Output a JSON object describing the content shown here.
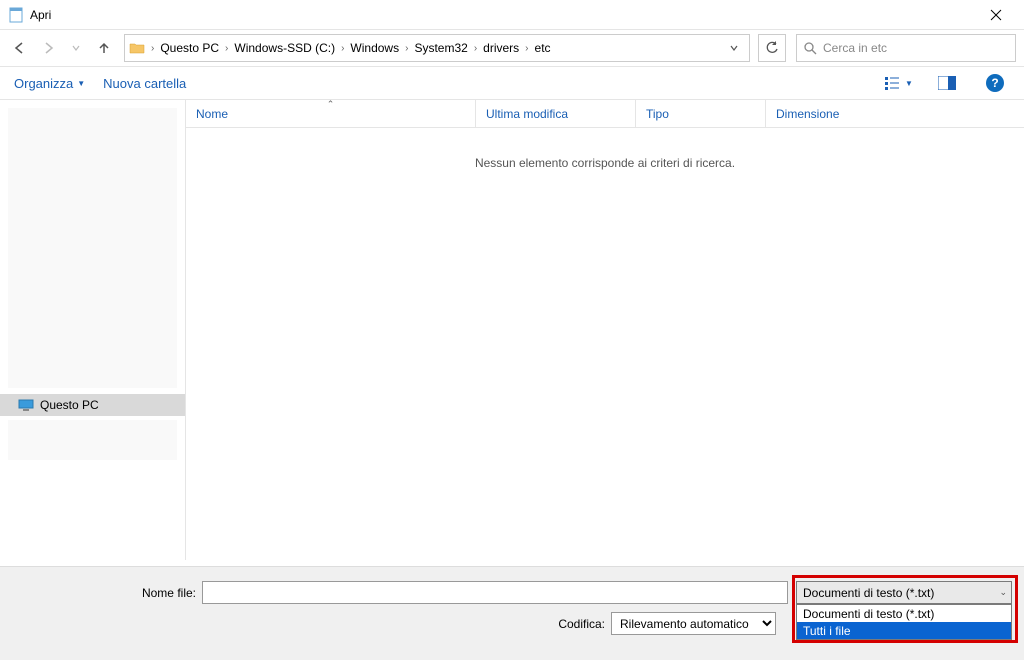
{
  "window": {
    "title": "Apri"
  },
  "breadcrumb": {
    "items": [
      "Questo PC",
      "Windows-SSD (C:)",
      "Windows",
      "System32",
      "drivers",
      "etc"
    ]
  },
  "search": {
    "placeholder": "Cerca in etc"
  },
  "commands": {
    "organize": "Organizza",
    "newfolder": "Nuova cartella"
  },
  "columns": {
    "name": "Nome",
    "modified": "Ultima modifica",
    "type": "Tipo",
    "size": "Dimensione"
  },
  "empty_message": "Nessun elemento corrisponde ai criteri di ricerca.",
  "sidebar": {
    "thispc": "Questo PC"
  },
  "bottom": {
    "filename_label": "Nome file:",
    "encoding_label": "Codifica:",
    "encoding_value": "Rilevamento automatico",
    "filetype_selected": "Documenti di testo (*.txt)",
    "filetype_options": [
      "Documenti di testo (*.txt)",
      "Tutti i file"
    ]
  }
}
